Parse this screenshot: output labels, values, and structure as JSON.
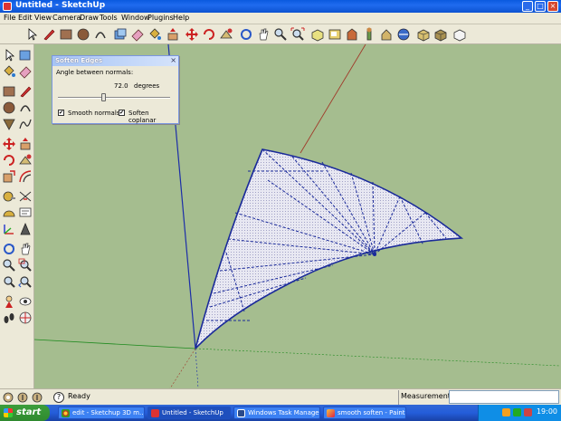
{
  "window": {
    "title": "Untitled - SketchUp"
  },
  "menu": [
    "File",
    "Edit",
    "View",
    "Camera",
    "Draw",
    "Tools",
    "Window",
    "Plugins",
    "Help"
  ],
  "dialog": {
    "title": "Soften Edges",
    "close_glyph": "×",
    "angle_label": "Angle between normals:",
    "angle_value": "72.0",
    "angle_unit": "degrees",
    "slider_fraction": 0.4,
    "smooth_normals_label": "Smooth normals",
    "smooth_normals_checked": true,
    "soften_coplanar_label": "Soften coplanar",
    "soften_coplanar_checked": true
  },
  "status": {
    "text": "Ready",
    "help_glyph": "?",
    "measurements_label": "Measurements",
    "measurements_value": ""
  },
  "taskbar": {
    "start_label": "start",
    "tasks": [
      {
        "label": "edit - Sketchup 3D m...",
        "active": false
      },
      {
        "label": "Untitled - SketchUp",
        "active": true
      },
      {
        "label": "Windows Task Manager",
        "active": false
      },
      {
        "label": "smooth soften - Paint",
        "active": false
      }
    ],
    "clock": "19:00"
  },
  "colors": {
    "viewport_bg": "#a5bd8f",
    "blue_axis": "#1c2ea8",
    "red_axis": "#a03a2a",
    "green_axis": "#1f8a1f",
    "edge": "#1a2a9a",
    "face": "#e4e4f0"
  },
  "icons": {
    "top_toolbar": [
      "select-icon",
      "pencil-icon",
      "rectangle-icon",
      "circle-icon",
      "arc-icon",
      "component-icon",
      "eraser-icon",
      "paint-bucket-icon",
      "push-pull-icon",
      "move-icon",
      "rotate-icon",
      "follow-me-icon",
      "orbit-icon",
      "pan-icon",
      "zoom-icon",
      "zoom-extents-icon",
      "iso-view-icon",
      "top-view-icon",
      "front-view-icon",
      "right-view-icon",
      "back-view-icon",
      "left-view-icon",
      "xray-icon",
      "wireframe-icon",
      "hidden-line-icon",
      "shaded-icon",
      "textured-icon",
      "monochrome-icon"
    ],
    "left_toolbar": [
      "select-icon",
      "make-component-icon",
      "paint-bucket-icon",
      "eraser-icon",
      "rectangle-icon",
      "line-icon",
      "circle-icon",
      "arc-icon",
      "polygon-icon",
      "freehand-icon",
      "move-icon",
      "push-pull-icon",
      "rotate-icon",
      "follow-me-icon",
      "scale-icon",
      "offset-icon",
      "tape-measure-icon",
      "dimension-icon",
      "protractor-icon",
      "text-icon",
      "axes-icon",
      "3d-text-icon",
      "orbit-icon",
      "pan-icon",
      "zoom-icon",
      "zoom-window-icon",
      "zoom-extents-icon",
      "previous-view-icon",
      "position-camera-icon",
      "look-around-icon",
      "walk-icon",
      "section-plane-icon"
    ]
  }
}
